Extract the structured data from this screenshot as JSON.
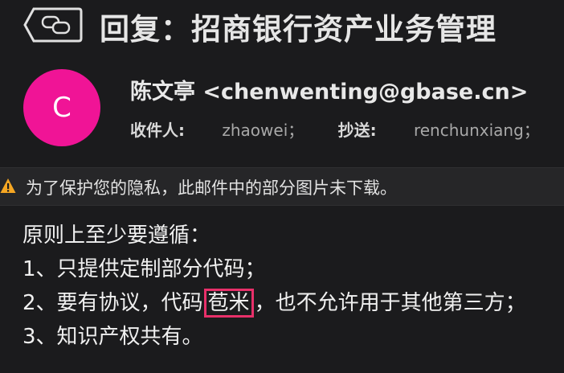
{
  "header": {
    "subject": "回复：招商银行资产业务管理"
  },
  "message": {
    "avatar_initial": "C",
    "sender": "陈文亭 <chenwenting@gbase.cn>",
    "to_label": "收件人:",
    "to_value": "zhaowei；",
    "cc_label": "抄送:",
    "cc_value": "renchunxiang；"
  },
  "privacy_notice": "为了保护您的隐私，此邮件中的部分图片未下载。",
  "body": {
    "line1": "原则上至少要遵循：",
    "line2": "1、只提供定制部分代码；",
    "line3_before": "2、要有协议，代码",
    "line3_highlight": "苞米",
    "line3_after": "，也不允许用于其他第三方；",
    "line4": "3、知识产权共有。"
  },
  "colors": {
    "avatar": "#f01496",
    "highlight_border": "#e8306a",
    "warning": "#f5a623"
  }
}
